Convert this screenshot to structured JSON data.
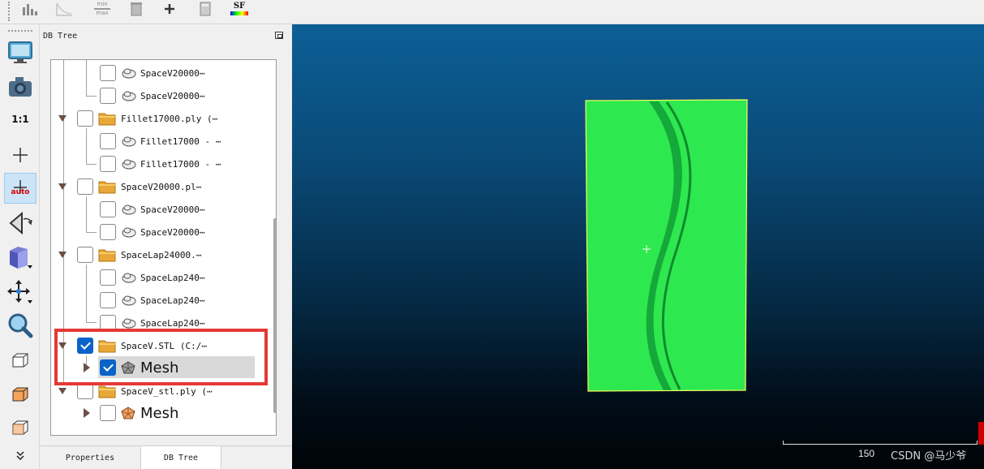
{
  "toolbar": {
    "icons": [
      "histogram-icon",
      "curve-icon",
      "min-max-icon",
      "trash-table-icon",
      "plus-icon",
      "calculator-icon",
      "sf-color-icon"
    ],
    "min_max_text_top": "min",
    "min_max_text_bottom": "max",
    "sf_text": "SF"
  },
  "left_toolbar": {
    "one_to_one_label": "1:1",
    "auto_label": "auto"
  },
  "panel": {
    "title": "DB Tree"
  },
  "tree": {
    "rows": [
      {
        "label": "SpaceV20000⋯"
      },
      {
        "label": "SpaceV20000⋯"
      },
      {
        "label": "Fillet17000.ply (⋯"
      },
      {
        "label": "Fillet17000 - ⋯"
      },
      {
        "label": "Fillet17000 - ⋯"
      },
      {
        "label": "SpaceV20000.pl⋯"
      },
      {
        "label": "SpaceV20000⋯"
      },
      {
        "label": "SpaceV20000⋯"
      },
      {
        "label": "SpaceLap24000.⋯"
      },
      {
        "label": "SpaceLap240⋯"
      },
      {
        "label": "SpaceLap240⋯"
      },
      {
        "label": "SpaceLap240⋯"
      },
      {
        "label": "SpaceV.STL (C:/⋯"
      },
      {
        "label": "Mesh"
      },
      {
        "label": "SpaceV_stl.ply (⋯"
      },
      {
        "label": "Mesh"
      }
    ]
  },
  "tabs": {
    "properties": "Properties",
    "db_tree": "DB Tree"
  },
  "view": {
    "scale_value": "150",
    "watermark": "CSDN @马少爷",
    "mesh_color": "#33ee55",
    "bbox_color": "#ffff66"
  }
}
